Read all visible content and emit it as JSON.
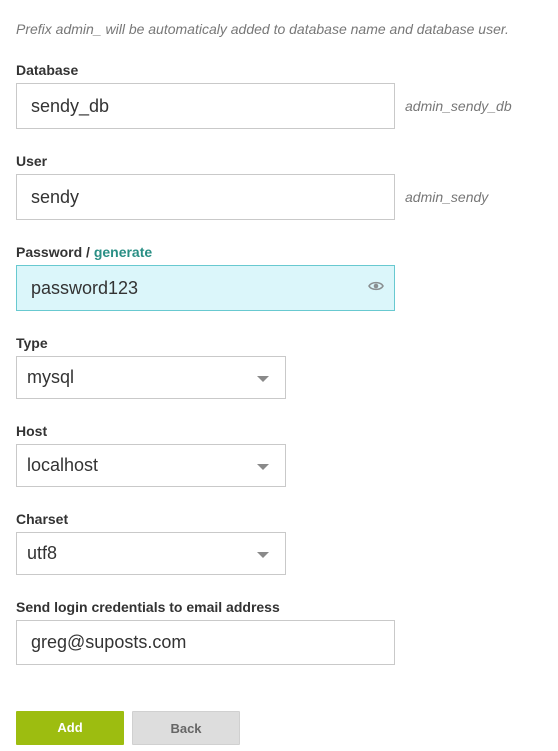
{
  "prefix_note": "Prefix admin_ will be automaticaly added to database name and database user.",
  "database": {
    "label": "Database",
    "value": "sendy_db",
    "hint": "admin_sendy_db"
  },
  "user": {
    "label": "User",
    "value": "sendy",
    "hint": "admin_sendy"
  },
  "password": {
    "label": "Password / ",
    "generate_link": "generate",
    "value": "password123",
    "toggle_icon": "eye-icon"
  },
  "type": {
    "label": "Type",
    "selected": "mysql"
  },
  "host": {
    "label": "Host",
    "selected": "localhost"
  },
  "charset": {
    "label": "Charset",
    "selected": "utf8"
  },
  "email": {
    "label": "Send login credentials to email address",
    "value": "greg@suposts.com"
  },
  "buttons": {
    "add": "Add",
    "back": "Back"
  },
  "colors": {
    "accent_green": "#9dbd10",
    "link_teal": "#2a8f85",
    "focus_bg": "#dbf6fa"
  }
}
